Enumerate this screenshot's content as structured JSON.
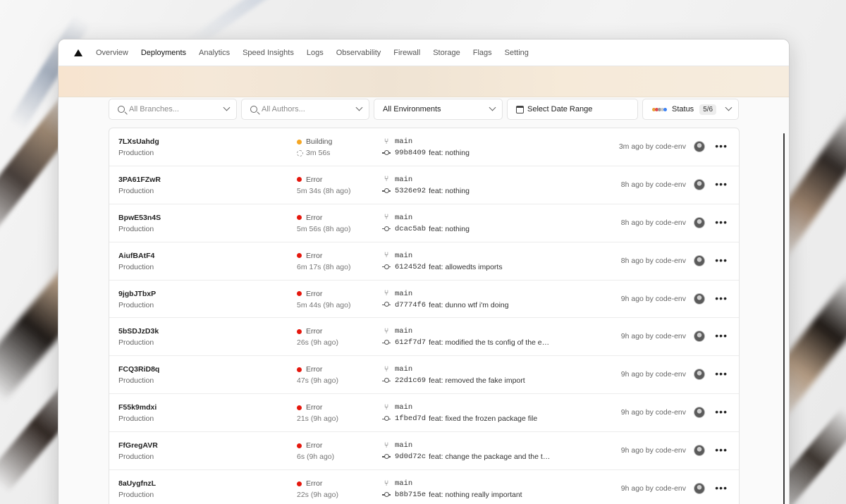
{
  "nav": {
    "items": [
      {
        "label": "Overview",
        "active": false
      },
      {
        "label": "Deployments",
        "active": true
      },
      {
        "label": "Analytics",
        "active": false
      },
      {
        "label": "Speed Insights",
        "active": false
      },
      {
        "label": "Logs",
        "active": false
      },
      {
        "label": "Observability",
        "active": false
      },
      {
        "label": "Firewall",
        "active": false
      },
      {
        "label": "Storage",
        "active": false
      },
      {
        "label": "Flags",
        "active": false
      },
      {
        "label": "Setting",
        "active": false
      }
    ]
  },
  "filters": {
    "branches_placeholder": "All Branches...",
    "authors_placeholder": "All Authors...",
    "environment_value": "All Environments",
    "date_range_label": "Select Date Range",
    "status_label": "Status",
    "status_count": "5/6",
    "status_colors": [
      "#e8a23a",
      "#e5484d",
      "#9a9a9a",
      "#c9c9c9",
      "#3b82f6"
    ]
  },
  "colors": {
    "building": "#f5a623",
    "error": "#e5170d"
  },
  "deployments": [
    {
      "id": "7LXsUahdg",
      "env": "Production",
      "status": "Building",
      "status_type": "building",
      "duration": "3m 56s",
      "branch": "main",
      "commit_hash": "99b8409",
      "commit_msg": "feat: nothing",
      "time_by": "3m ago by code-env"
    },
    {
      "id": "3PA61FZwR",
      "env": "Production",
      "status": "Error",
      "status_type": "error",
      "duration": "5m 34s (8h ago)",
      "branch": "main",
      "commit_hash": "5326e92",
      "commit_msg": "feat: nothing",
      "time_by": "8h ago by code-env"
    },
    {
      "id": "BpwE53n4S",
      "env": "Production",
      "status": "Error",
      "status_type": "error",
      "duration": "5m 56s (8h ago)",
      "branch": "main",
      "commit_hash": "dcac5ab",
      "commit_msg": "feat: nothing",
      "time_by": "8h ago by code-env"
    },
    {
      "id": "AiufBAtF4",
      "env": "Production",
      "status": "Error",
      "status_type": "error",
      "duration": "6m 17s (8h ago)",
      "branch": "main",
      "commit_hash": "612452d",
      "commit_msg": "feat: allowedts imports",
      "time_by": "8h ago by code-env"
    },
    {
      "id": "9jgbJTbxP",
      "env": "Production",
      "status": "Error",
      "status_type": "error",
      "duration": "5m 44s (9h ago)",
      "branch": "main",
      "commit_hash": "d7774f6",
      "commit_msg": "feat: dunno wtf i'm doing",
      "time_by": "9h ago by code-env"
    },
    {
      "id": "5bSDJzD3k",
      "env": "Production",
      "status": "Error",
      "status_type": "error",
      "duration": "26s (9h ago)",
      "branch": "main",
      "commit_hash": "612f7d7",
      "commit_msg": "feat: modified the ts config of the e…",
      "time_by": "9h ago by code-env"
    },
    {
      "id": "FCQ3RiD8q",
      "env": "Production",
      "status": "Error",
      "status_type": "error",
      "duration": "47s (9h ago)",
      "branch": "main",
      "commit_hash": "22d1c69",
      "commit_msg": "feat: removed the fake import",
      "time_by": "9h ago by code-env"
    },
    {
      "id": "F55k9mdxi",
      "env": "Production",
      "status": "Error",
      "status_type": "error",
      "duration": "21s (9h ago)",
      "branch": "main",
      "commit_hash": "1fbed7d",
      "commit_msg": "feat: fixed the frozen package file",
      "time_by": "9h ago by code-env"
    },
    {
      "id": "FfGregAVR",
      "env": "Production",
      "status": "Error",
      "status_type": "error",
      "duration": "6s (9h ago)",
      "branch": "main",
      "commit_hash": "9d0d72c",
      "commit_msg": "feat: change the package and the t…",
      "time_by": "9h ago by code-env"
    },
    {
      "id": "8aUygfnzL",
      "env": "Production",
      "status": "Error",
      "status_type": "error",
      "duration": "22s (9h ago)",
      "branch": "main",
      "commit_hash": "b8b715e",
      "commit_msg": "feat: nothing really important",
      "time_by": "9h ago by code-env"
    }
  ]
}
